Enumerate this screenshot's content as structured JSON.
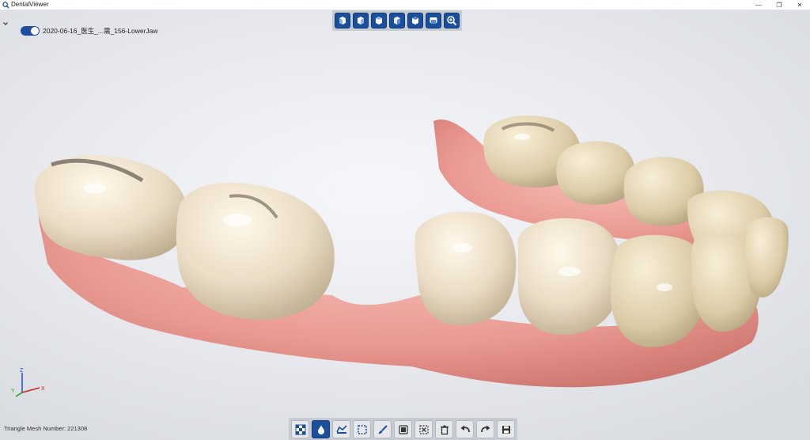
{
  "window": {
    "title": "DentalViewer",
    "controls": {
      "minimize": "—",
      "restore": "❐",
      "close": "✕"
    }
  },
  "model": {
    "name": "2020-06-16_医生_...需_156-LowerJaw",
    "visible": true
  },
  "view_toolbar": {
    "buttons": [
      "front-view",
      "back-view",
      "left-view",
      "right-view",
      "top-view",
      "bottom-view",
      "zoom-fit"
    ]
  },
  "edit_toolbar": {
    "buttons": [
      "texture-toggle",
      "color-toggle",
      "cut-plane",
      "box-select",
      "brush",
      "select-mesh",
      "deselect",
      "delete",
      "undo",
      "redo",
      "save"
    ]
  },
  "axis": {
    "x": "X",
    "y": "Y",
    "z": "Z"
  },
  "status": {
    "mesh_label": "Triangle Mesh Number: ",
    "mesh_count": "221308"
  },
  "colors": {
    "accent": "#1b4f9c",
    "gum": "#e89a92",
    "tooth": "#eadcc4",
    "background": "#e7e9ee"
  }
}
